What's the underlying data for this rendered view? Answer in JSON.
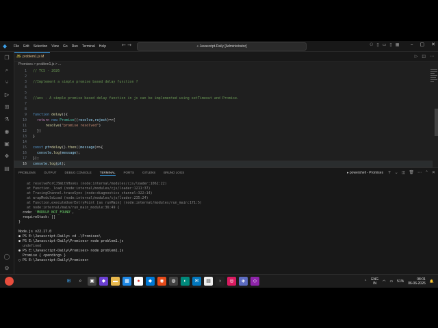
{
  "window": {
    "menu": [
      "File",
      "Edit",
      "Selection",
      "View",
      "Go",
      "Run",
      "Terminal",
      "Help"
    ],
    "search_text": "Javascript-Daily [Administrator]"
  },
  "tab": {
    "label": "problem1.js M",
    "icon": "JS"
  },
  "breadcrumb": "Promises > problem1.js > ...",
  "editor": {
    "lines": [
      {
        "n": "1",
        "t": "com",
        "text": "// TCS - 2026"
      },
      {
        "n": "2",
        "t": "plain",
        "text": ""
      },
      {
        "n": "3",
        "t": "com",
        "text": "//Implement a simple promise based delay function ?"
      },
      {
        "n": "4",
        "t": "plain",
        "text": ""
      },
      {
        "n": "5",
        "t": "plain",
        "text": ""
      },
      {
        "n": "6",
        "t": "com",
        "text": "//ans - A simple promise based delay function in js can be implemented using setTimeout and Promise."
      },
      {
        "n": "7",
        "t": "plain",
        "text": ""
      },
      {
        "n": "8",
        "t": "plain",
        "text": ""
      },
      {
        "n": "9",
        "t": "fndecl",
        "text": "function delay(){"
      },
      {
        "n": "10",
        "t": "ret",
        "text": "  return new Promise((resolve,reject)=>{"
      },
      {
        "n": "11",
        "t": "call",
        "text": "      resolve(\"promise resolved\")"
      },
      {
        "n": "12",
        "t": "plain",
        "text": "  })"
      },
      {
        "n": "13",
        "t": "plain",
        "text": "}"
      },
      {
        "n": "14",
        "t": "plain",
        "text": ""
      },
      {
        "n": "15",
        "t": "then",
        "text": "const pt=delay().then((message)=>{"
      },
      {
        "n": "16",
        "t": "log",
        "text": "  console.log(message);"
      },
      {
        "n": "17",
        "t": "plain",
        "text": "});"
      },
      {
        "n": "16",
        "t": "last",
        "text": "console.log(pt);"
      }
    ]
  },
  "panel": {
    "tabs": [
      "PROBLEMS",
      "OUTPUT",
      "DEBUG CONSOLE",
      "TERMINAL",
      "PORTS",
      "GITLENS",
      "BRUNO LOGS"
    ],
    "active_tab": "TERMINAL",
    "shell": "powershell - Promises"
  },
  "terminal": {
    "lines": [
      {
        "c": "dim",
        "text": "    at resolveForCJSWithHooks (node:internal/modules/cjs/loader:1062:22)"
      },
      {
        "c": "dim",
        "text": "    at Function._load (node:internal/modules/cjs/loader:1211:37)"
      },
      {
        "c": "dim",
        "text": "    at TracingChannel.traceSync (node:diagnostics_channel:322:14)"
      },
      {
        "c": "dim",
        "text": "    at wrapModuleLoad (node:internal/modules/cjs/loader:235:24)"
      },
      {
        "c": "dim",
        "text": "    at Function.executeUserEntryPoint [as runMain] (node:internal/modules/run_main:171:5)"
      },
      {
        "c": "dim",
        "text": "    at node:internal/main/run_main_module:36:49 {"
      },
      {
        "c": "code",
        "text": "  code: 'MODULE_NOT_FOUND',"
      },
      {
        "c": "plain",
        "text": "  requireStack: []"
      },
      {
        "c": "plain",
        "text": "}"
      },
      {
        "c": "plain",
        "text": ""
      },
      {
        "c": "plain",
        "text": "Node.js v22.17.0"
      },
      {
        "c": "plain",
        "text": "● PS E:\\Javascript-Daily> cd .\\Promises\\"
      },
      {
        "c": "plain",
        "text": "● PS E:\\Javascript-Daily\\Promises> node problem1.js"
      },
      {
        "c": "dim",
        "text": "  undefined"
      },
      {
        "c": "plain",
        "text": "● PS E:\\Javascript-Daily\\Promises> node problem1.js"
      },
      {
        "c": "plain",
        "text": "  Promise { <pending> }"
      },
      {
        "c": "plain",
        "text": "○ PS E:\\Javascript-Daily\\Promises> "
      }
    ]
  },
  "statusbar": {
    "left": [
      "main*",
      "⊗ 0 ⚠ 0",
      "Launchpad",
      "Bootstrap v5.3.8"
    ],
    "right": [
      "You, now",
      "Ln 16, Col 17",
      "Spaces: 2",
      "UTF-8",
      "CRLF",
      "{} JavaScript",
      "Go Live",
      "Ninja",
      "Prettier"
    ]
  },
  "taskbar": {
    "lang_top": "ENG",
    "lang_bottom": "IN",
    "battery": "51%",
    "time": "08:01",
    "date": "06-06-2026"
  }
}
